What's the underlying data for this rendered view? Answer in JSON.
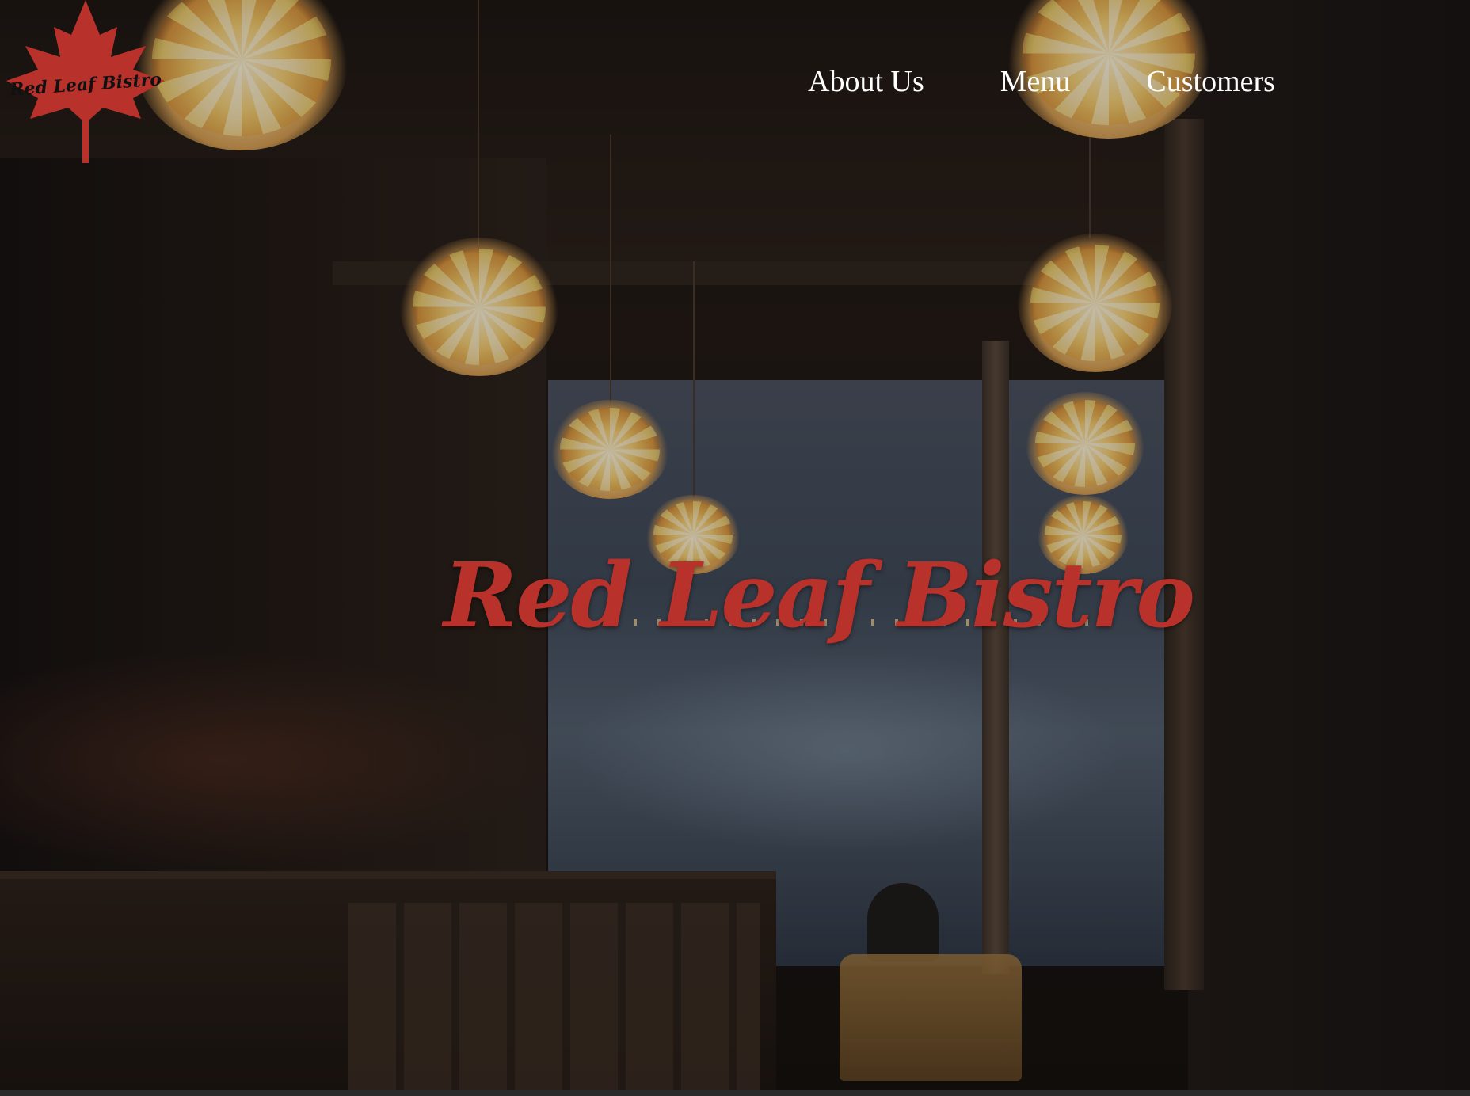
{
  "header": {
    "logo": {
      "text": "Red Leaf Bistro",
      "icon": "maple-leaf-icon",
      "color": "#b8312a"
    },
    "nav": {
      "items": [
        {
          "label": "About Us"
        },
        {
          "label": "Menu"
        },
        {
          "label": "Customers"
        }
      ]
    }
  },
  "hero": {
    "title": "Red Leaf Bistro",
    "title_color": "#b8312a",
    "background": "dim bistro interior photo with pendant lamps"
  }
}
